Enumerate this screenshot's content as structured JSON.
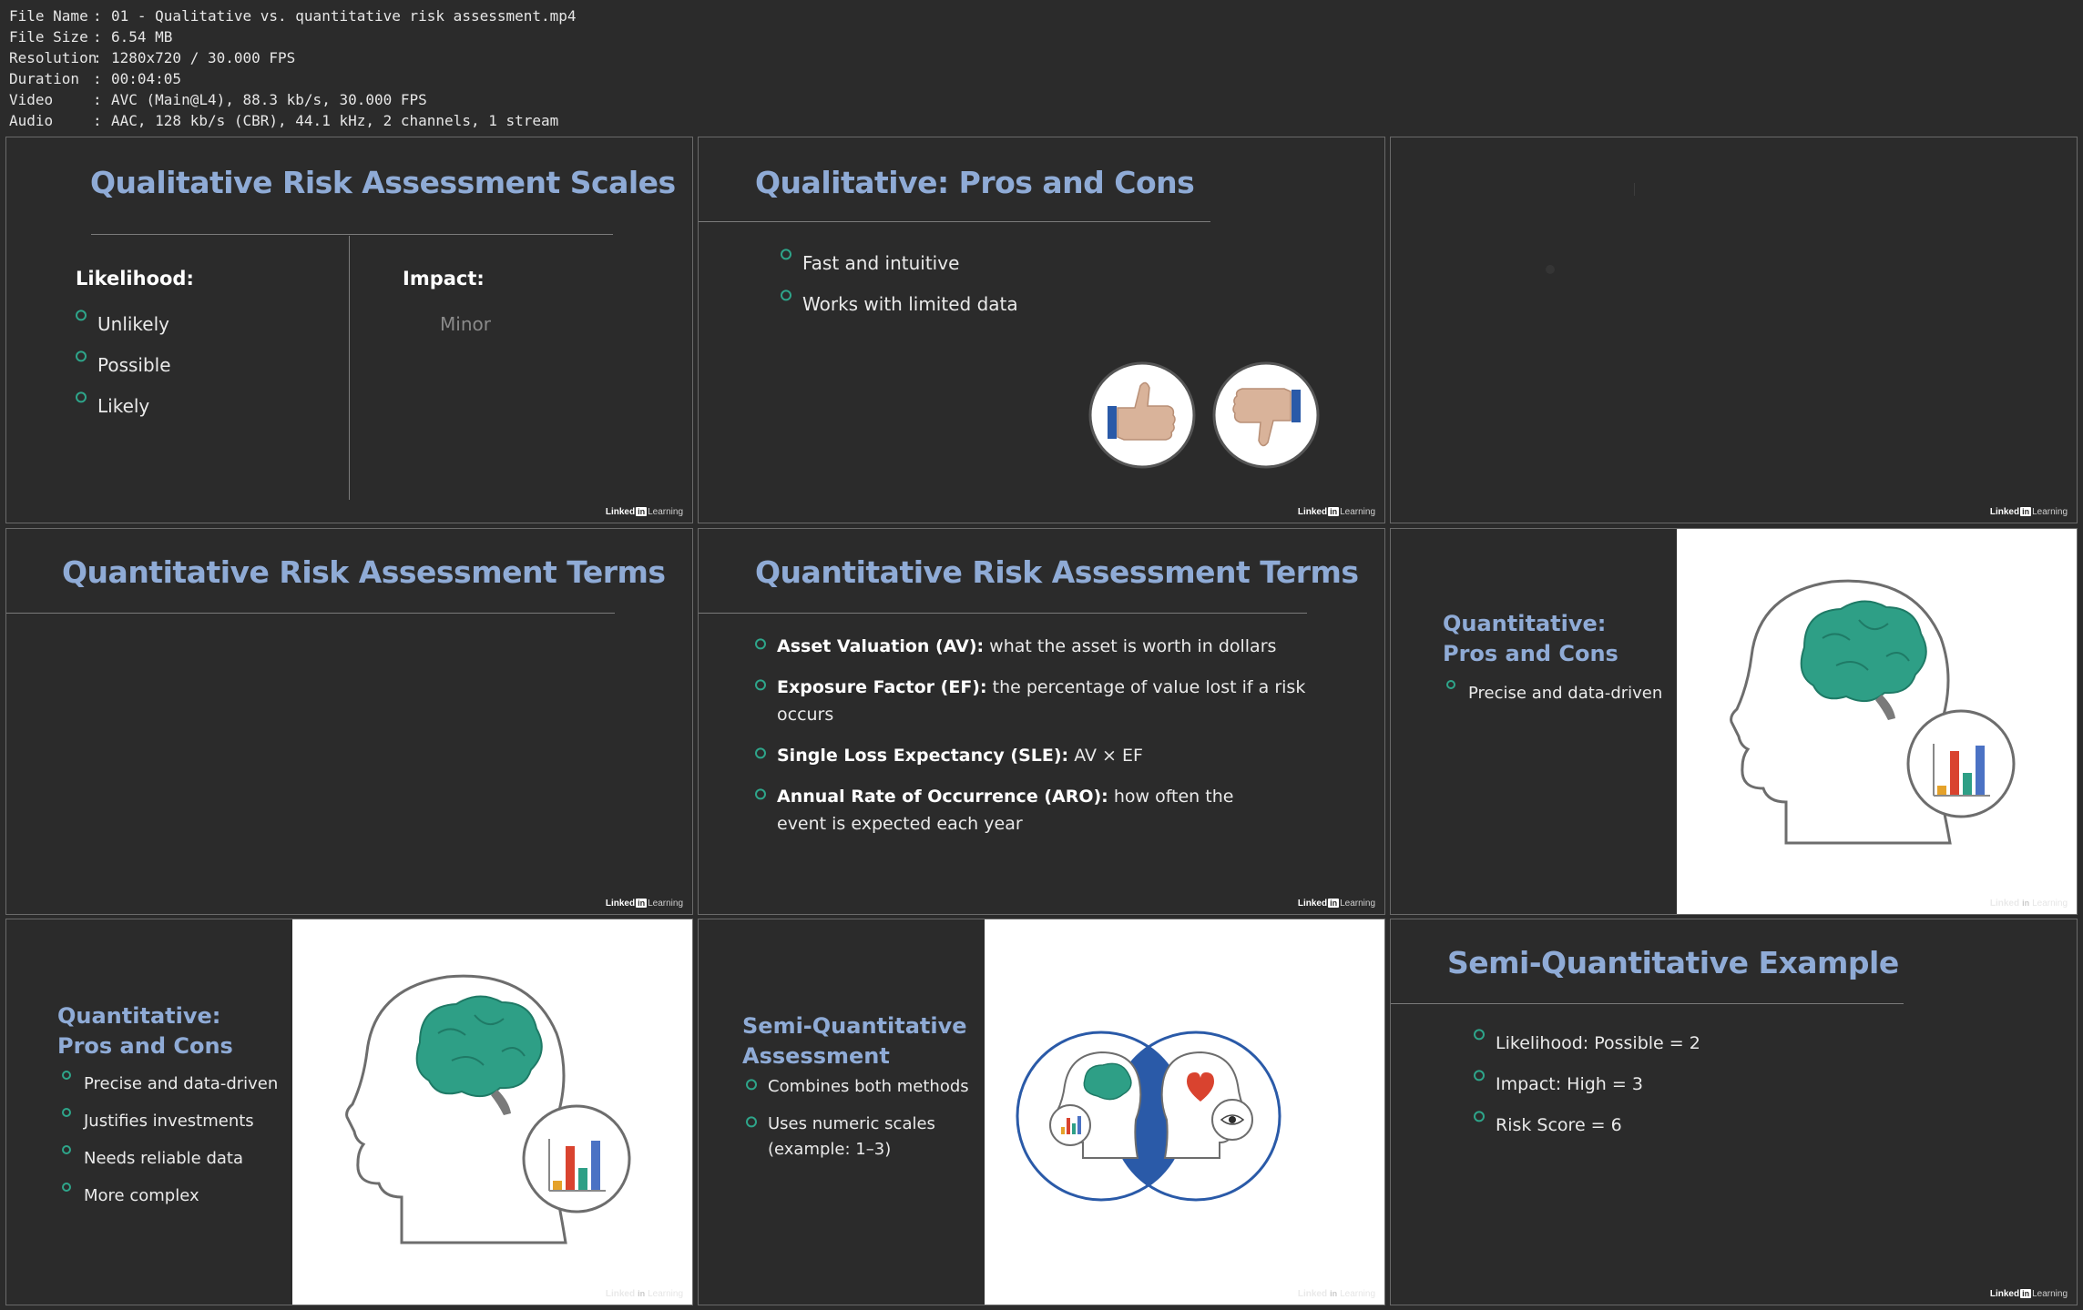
{
  "file_info": [
    {
      "key": "File Name",
      "value": "01 - Qualitative vs. quantitative risk assessment.mp4"
    },
    {
      "key": "File Size",
      "value": "6.54 MB"
    },
    {
      "key": "Resolution",
      "value": "1280x720 / 30.000 FPS"
    },
    {
      "key": "Duration",
      "value": "00:04:05"
    },
    {
      "key": "Video",
      "value": "AVC (Main@L4), 88.3 kb/s, 30.000 FPS"
    },
    {
      "key": "Audio",
      "value": "AAC, 128 kb/s (CBR), 44.1 kHz, 2 channels, 1 stream"
    }
  ],
  "brand": {
    "left": "Linked",
    "mark": "in",
    "right": "Learning"
  },
  "colors": {
    "title": "#8fabd6",
    "bullet": "#2ea58a",
    "background": "#2b2b2b",
    "brain": "#2e9f86",
    "blue_accent": "#2a5aa8"
  },
  "frames": {
    "f1": {
      "title": "Qualitative Risk Assessment Scales",
      "likelihood_label": "Likelihood:",
      "likelihood": [
        "Unlikely",
        "Possible",
        "Likely"
      ],
      "impact_label": "Impact:",
      "impact": [
        "Minor"
      ]
    },
    "f2": {
      "title": "Qualitative: Pros and Cons",
      "bullets": [
        "Fast and intuitive",
        "Works with limited data"
      ],
      "icons": [
        "thumbs-up-icon",
        "thumbs-down-icon"
      ]
    },
    "f4": {
      "title": "Quantitative Risk Assessment Terms"
    },
    "f5": {
      "title": "Quantitative Risk Assessment Terms",
      "terms": [
        {
          "term": "Asset Valuation (AV):",
          "desc": " what the asset is worth in dollars"
        },
        {
          "term": "Exposure Factor (EF):",
          "desc": " the percentage of value lost if a risk occurs"
        },
        {
          "term": "Single Loss Expectancy (SLE):",
          "desc": " AV × EF"
        },
        {
          "term": "Annual Rate of Occurrence (ARO):",
          "desc": " how often the event is expected each year"
        }
      ]
    },
    "f6": {
      "title_line1": "Quantitative:",
      "title_line2": "Pros and Cons",
      "bullets": [
        "Precise and data-driven"
      ]
    },
    "f7": {
      "title_line1": "Quantitative:",
      "title_line2": "Pros and Cons",
      "bullets": [
        "Precise and data-driven",
        "Justifies investments",
        "Needs reliable data",
        "More complex"
      ]
    },
    "f8": {
      "title_line1": "Semi-Quantitative",
      "title_line2": "Assessment",
      "bullets": [
        "Combines both methods",
        "Uses numeric scales (example: 1–3)"
      ]
    },
    "f9": {
      "title": "Semi-Quantitative Example",
      "bullets": [
        "Likelihood: Possible = 2",
        "Impact: High = 3",
        "Risk Score = 6"
      ]
    }
  }
}
